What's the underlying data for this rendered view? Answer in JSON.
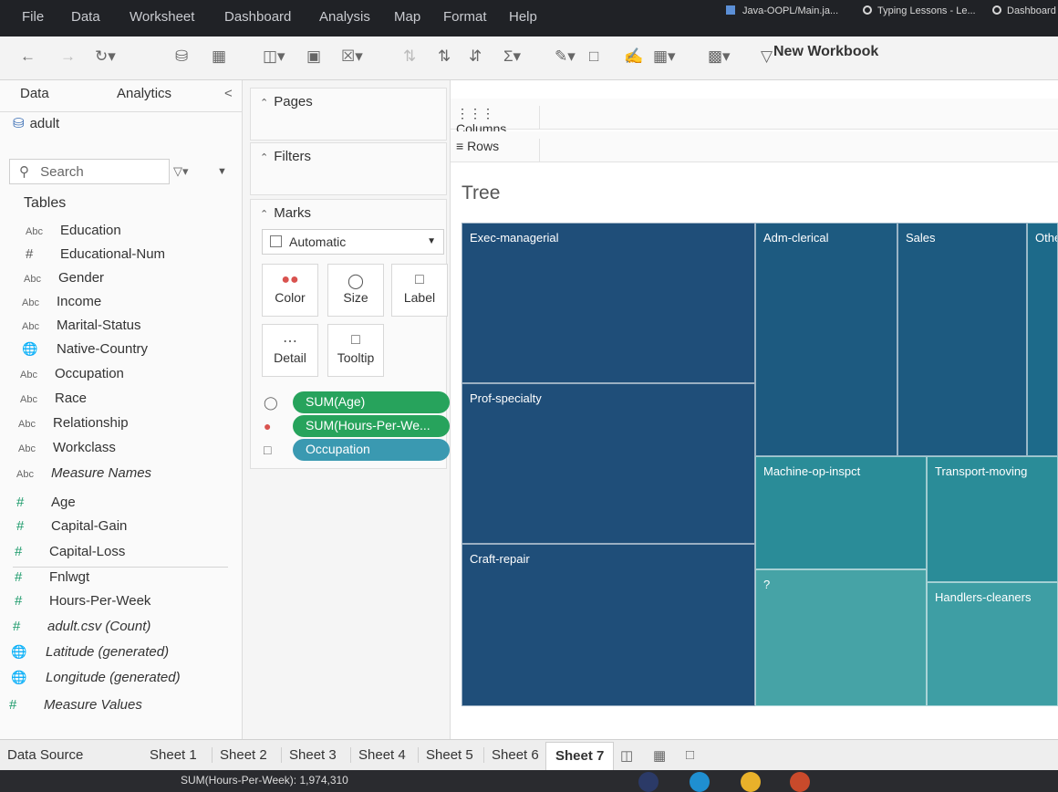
{
  "menu": {
    "items": [
      "File",
      "Data",
      "Worksheet",
      "Dashboard",
      "Analysis",
      "Map",
      "Format",
      "Help"
    ]
  },
  "window_tabs": {
    "tab1": "Java-OOPL/Main.ja...",
    "tab2": "Typing Lessons - Le...",
    "tab3": "Dashboard"
  },
  "toolbar": {
    "workbook_title": "New Workbook",
    "icons": [
      "back-icon",
      "forward-icon",
      "redo-icon",
      "new-datasource-icon",
      "pause-icon",
      "new-sheet-icon",
      "duplicate-icon",
      "clear-icon",
      "swap-icon",
      "sort-ascending-icon",
      "sort-descending-icon",
      "totals-icon",
      "highlight-icon",
      "label-icon",
      "annotate-icon",
      "fit-icon",
      "show-me-icon",
      "present-icon"
    ]
  },
  "data_pane": {
    "data_tab": "Data",
    "analytics_tab": "Analytics",
    "datasource": "adult",
    "search_placeholder": "Search",
    "tables_heading": "Tables",
    "dimensions": [
      {
        "type": "Abc",
        "name": "Education"
      },
      {
        "type": "#",
        "name": "Educational-Num"
      },
      {
        "type": "Abc",
        "name": "Gender"
      },
      {
        "type": "Abc",
        "name": "Income"
      },
      {
        "type": "Abc",
        "name": "Marital-Status"
      },
      {
        "type": "globe",
        "name": "Native-Country"
      },
      {
        "type": "Abc",
        "name": "Occupation"
      },
      {
        "type": "Abc",
        "name": "Race"
      },
      {
        "type": "Abc",
        "name": "Relationship"
      },
      {
        "type": "Abc",
        "name": "Workclass"
      },
      {
        "type": "Abc",
        "name": "Measure Names"
      }
    ],
    "measures": [
      {
        "type": "#",
        "name": "Age"
      },
      {
        "type": "#",
        "name": "Capital-Gain"
      },
      {
        "type": "#",
        "name": "Capital-Loss"
      },
      {
        "type": "#",
        "name": "Fnlwgt"
      },
      {
        "type": "#",
        "name": "Hours-Per-Week"
      },
      {
        "type": "#",
        "name": "adult.csv (Count)"
      },
      {
        "type": "globe",
        "name": "Latitude (generated)"
      },
      {
        "type": "globe",
        "name": "Longitude (generated)"
      },
      {
        "type": "#",
        "name": "Measure Values"
      }
    ]
  },
  "cards": {
    "pages": "Pages",
    "filters": "Filters",
    "marks": "Marks",
    "mark_type": "Automatic",
    "buttons": {
      "color": "Color",
      "size": "Size",
      "label": "Label",
      "detail": "Detail",
      "tooltip": "Tooltip"
    },
    "pills": {
      "size": "SUM(Age)",
      "color": "SUM(Hours-Per-We...",
      "label": "Occupation"
    }
  },
  "shelves": {
    "columns": "Columns",
    "rows": "Rows"
  },
  "view": {
    "title": "Tree",
    "tiles": [
      {
        "label": "Exec-managerial"
      },
      {
        "label": "Prof-specialty"
      },
      {
        "label": "Craft-repair"
      },
      {
        "label": "Adm-clerical"
      },
      {
        "label": "Sales"
      },
      {
        "label": "Other"
      },
      {
        "label": "Machine-op-inspct"
      },
      {
        "label": "Transport-moving"
      },
      {
        "label": "?"
      },
      {
        "label": "Handlers-cleaners"
      }
    ]
  },
  "sheets": {
    "data_source": "Data Source",
    "tabs": [
      "Sheet 1",
      "Sheet 2",
      "Sheet 3",
      "Sheet 4",
      "Sheet 5",
      "Sheet 6",
      "Sheet 7"
    ],
    "active": "Sheet 7"
  },
  "status": {
    "text": "SUM(Hours-Per-Week): 1,974,310"
  },
  "colors": {
    "dark": "#1f4e79",
    "mid": "#1d6a8a",
    "teal": "#2a8c98",
    "light_teal": "#46a3a6"
  }
}
